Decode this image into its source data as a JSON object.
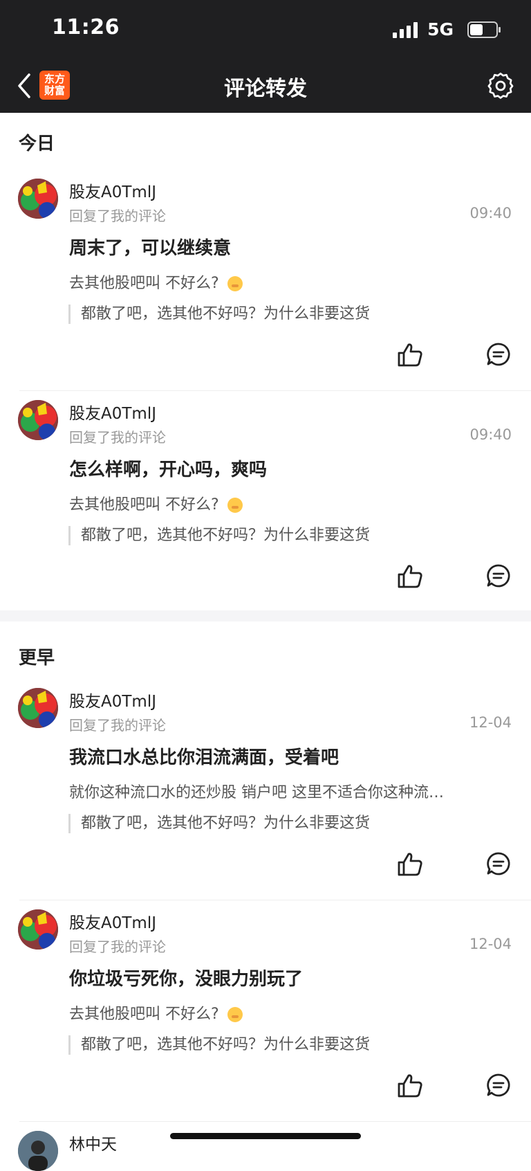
{
  "status_bar": {
    "time": "11:26",
    "network": "5G"
  },
  "nav": {
    "title": "评论转发",
    "logo_line1": "东方",
    "logo_line2": "财富"
  },
  "sections": {
    "today": {
      "title": "今日"
    },
    "earlier": {
      "title": "更早"
    }
  },
  "items": [
    {
      "name": "股友A0TmlJ",
      "action": "回复了我的评论",
      "time": "09:40",
      "comment": "周末了，可以继续意",
      "reply": "去其他股吧叫 不好么?",
      "quote": "都散了吧，选其他不好吗？为什么非要这货"
    },
    {
      "name": "股友A0TmlJ",
      "action": "回复了我的评论",
      "time": "09:40",
      "comment": "怎么样啊，开心吗，爽吗",
      "reply": "去其他股吧叫 不好么?",
      "quote": "都散了吧，选其他不好吗？为什么非要这货"
    },
    {
      "name": "股友A0TmlJ",
      "action": "回复了我的评论",
      "time": "12-04",
      "comment": "我流口水总比你泪流满面，受着吧",
      "reply": "就你这种流口水的还炒股 销户吧 这里不适合你这种流…",
      "quote": "都散了吧，选其他不好吗？为什么非要这货"
    },
    {
      "name": "股友A0TmlJ",
      "action": "回复了我的评论",
      "time": "12-04",
      "comment": "你垃圾亏死你，没眼力别玩了",
      "reply": "去其他股吧叫 不好么?",
      "quote": "都散了吧，选其他不好吗？为什么非要这货"
    }
  ],
  "partial_item": {
    "name": "林中天"
  },
  "icons": {
    "back": "chevron-left-icon",
    "settings": "gear-icon",
    "like": "thumbs-up-icon",
    "comment": "chat-bubble-icon",
    "emoji": "hand-over-mouth-emoji"
  },
  "colors": {
    "topbar": "#1f1f21",
    "logo": "#ff5a1a",
    "muted": "#999999"
  }
}
